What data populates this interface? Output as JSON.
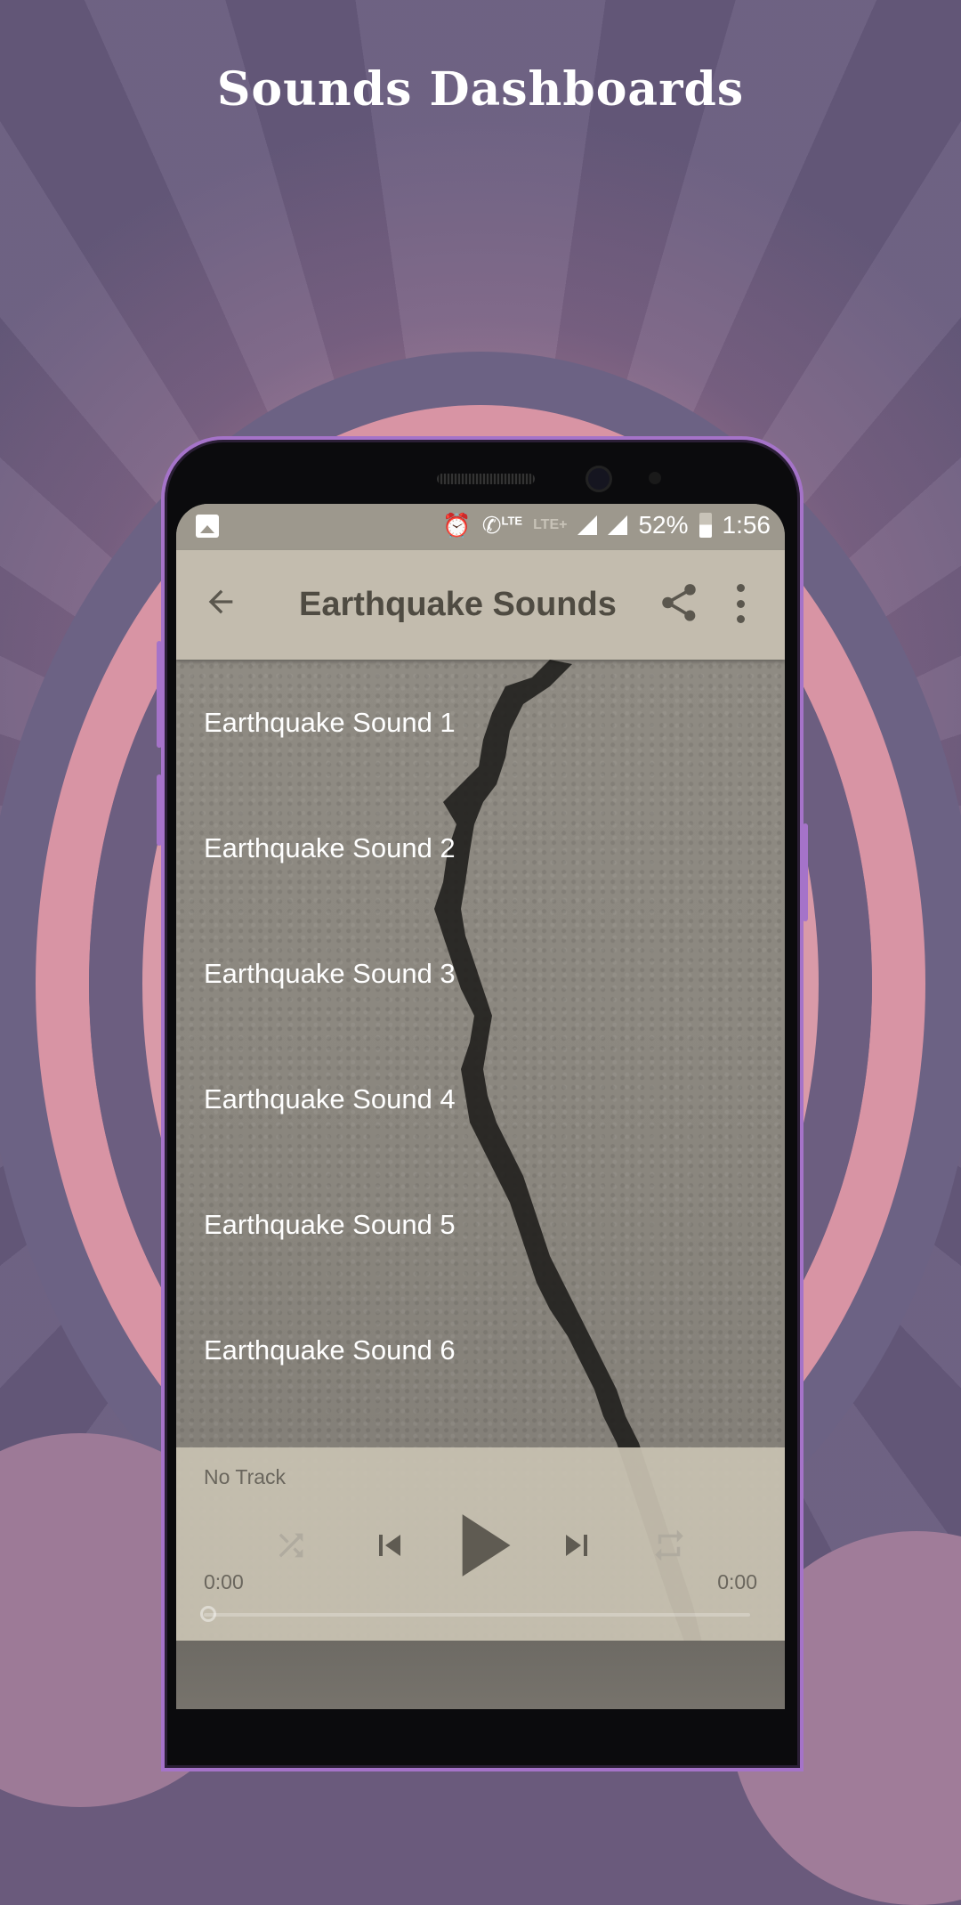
{
  "promo": {
    "title": "Sounds Dashboards"
  },
  "status_bar": {
    "left_icon": "image-notification-icon",
    "icons": [
      "alarm-icon",
      "volte-call-icon",
      "lte-plus-icon",
      "signal-icon",
      "signal-icon"
    ],
    "volte_label": "LTE",
    "lte_plus_label": "LTE+",
    "battery": "52%",
    "battery_level": 0.52,
    "time": "1:56"
  },
  "toolbar": {
    "back_icon": "arrow-back-icon",
    "title": "Earthquake Sounds",
    "share_icon": "share-icon",
    "more_icon": "more-vert-icon"
  },
  "list": {
    "items": [
      {
        "label": "Earthquake Sound 1"
      },
      {
        "label": "Earthquake Sound 2"
      },
      {
        "label": "Earthquake Sound 3"
      },
      {
        "label": "Earthquake Sound 4"
      },
      {
        "label": "Earthquake Sound 5"
      },
      {
        "label": "Earthquake Sound 6"
      }
    ]
  },
  "player": {
    "track": "No Track",
    "elapsed": "0:00",
    "duration": "0:00",
    "progress": 0,
    "controls": [
      "shuffle-icon",
      "skip-previous-icon",
      "play-icon",
      "skip-next-icon",
      "repeat-icon"
    ]
  },
  "colors": {
    "toolbar_bg": "#c3bcae",
    "statusbar_bg": "#9d988d",
    "player_bg": "#c8c2b2",
    "phone_frame": "#a573c9",
    "icon_dark": "#5b574e"
  }
}
